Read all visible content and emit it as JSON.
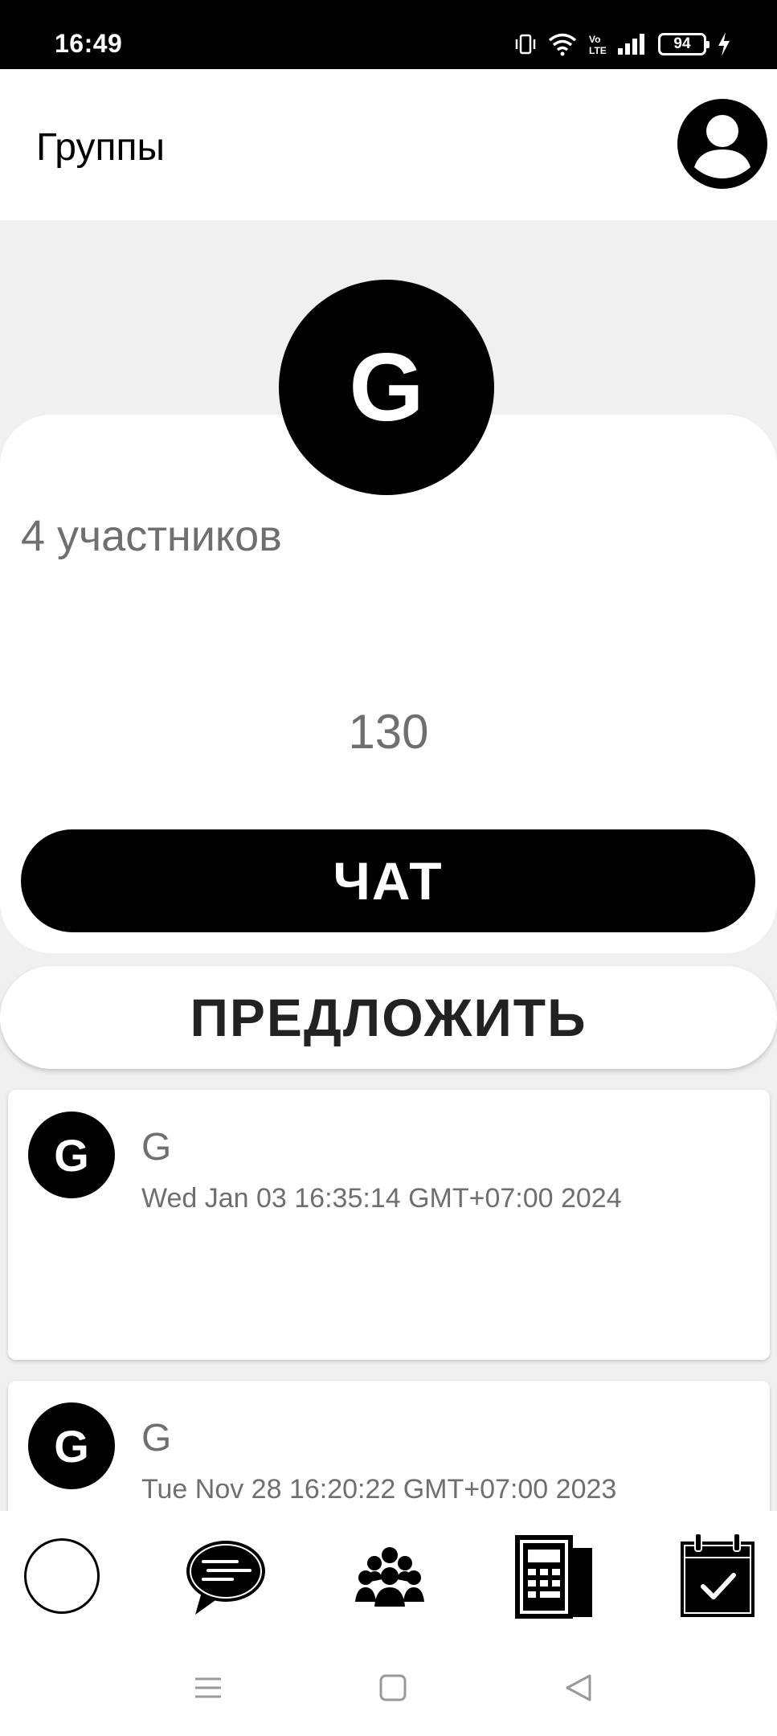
{
  "status_bar": {
    "time": "16:49",
    "battery": "94",
    "icons": [
      "vibrate-icon",
      "wifi-icon",
      "volte-icon",
      "signal-icon",
      "battery-icon",
      "charging-icon"
    ]
  },
  "header": {
    "title": "Группы",
    "profile_icon": "account-circle-icon"
  },
  "group": {
    "avatar_letter": "G",
    "members_text": "4 участников",
    "count": "130",
    "chat_button": "ЧАТ",
    "propose_button": "ПРЕДЛОЖИТЬ"
  },
  "posts": [
    {
      "avatar_letter": "G",
      "name": "G",
      "date": "Wed Jan 03 16:35:14 GMT+07:00 2024"
    },
    {
      "avatar_letter": "G",
      "name": "G",
      "date": "Tue Nov 28 16:20:22 GMT+07:00 2023"
    }
  ],
  "bottom_nav": {
    "items": [
      "circle-icon",
      "chat-bubble-icon",
      "group-icon",
      "calculator-document-icon",
      "calendar-check-icon"
    ]
  },
  "system_nav": [
    "menu-icon",
    "home-square-icon",
    "back-triangle-icon"
  ],
  "colors": {
    "primary": "#000000",
    "background": "#f0f0f0",
    "surface": "#ffffff",
    "muted_text": "#6f6f6f"
  }
}
